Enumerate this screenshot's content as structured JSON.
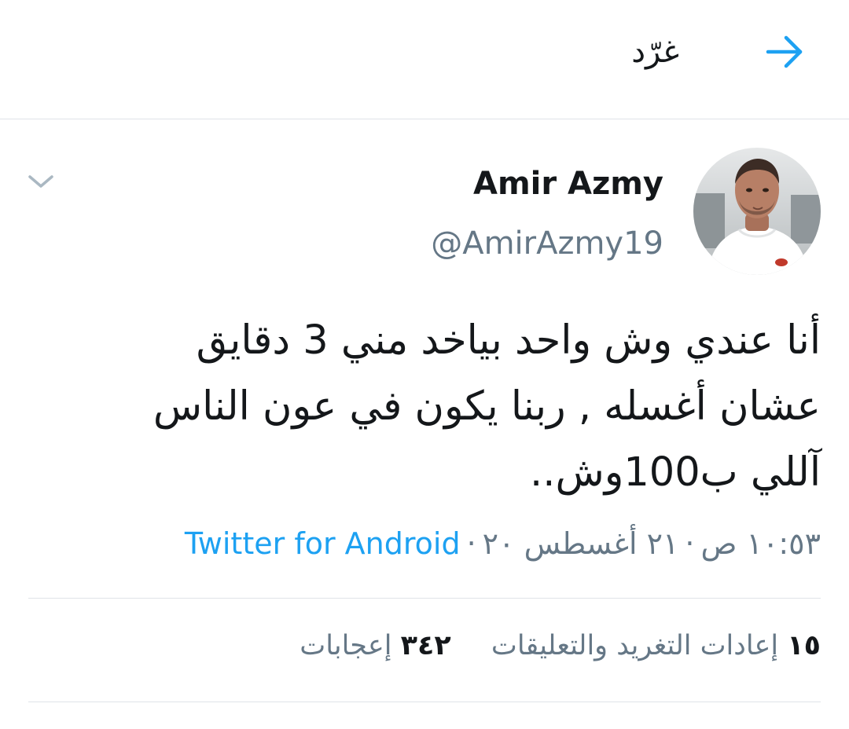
{
  "header": {
    "title": "غرّد",
    "back_icon": "arrow-right-icon",
    "accent": "#1da1f2"
  },
  "tweet": {
    "display_name": "Amir Azmy",
    "handle": "@AmirAzmy19",
    "avatar_icon": "user-avatar",
    "menu_icon": "chevron-down-icon",
    "text": "أنا عندي وش واحد بياخد مني 3 دقايق\nعشان أغسله , ربنا يكون في عون الناس\nآللي ب100وش..",
    "time": "١٠:٥٣ ص",
    "date": "٢١ أغسطس ٢٠",
    "separator": "·",
    "source": "Twitter for Android"
  },
  "stats": {
    "retweets_count": "١٥",
    "retweets_label": "إعادات التغريد والتعليقات",
    "likes_count": "٣٤٢",
    "likes_label": "إعجابات"
  },
  "colors": {
    "text_primary": "#14171a",
    "text_secondary": "#657786",
    "link": "#1da1f2",
    "divider": "#dfe3e8"
  }
}
